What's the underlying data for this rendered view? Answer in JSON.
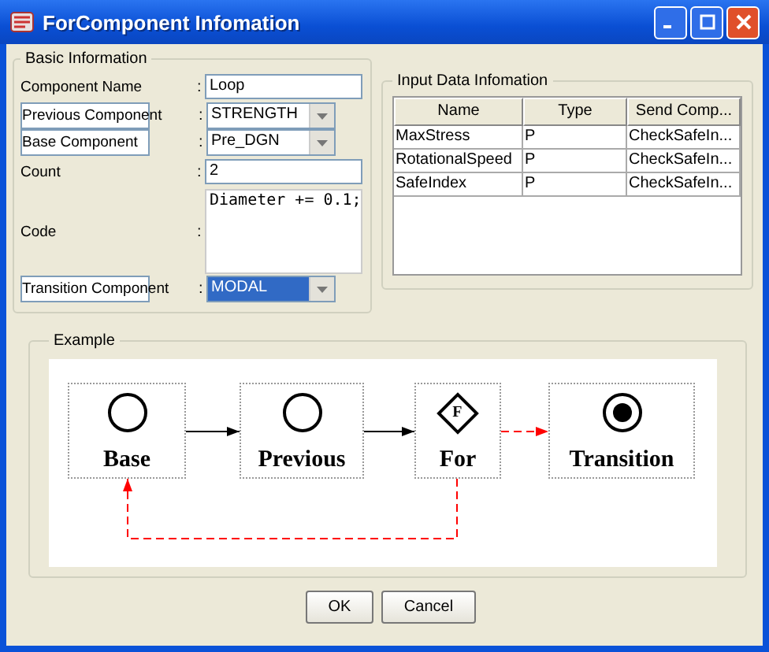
{
  "window": {
    "title": "ForComponent Infomation"
  },
  "basic_information": {
    "title": "Basic Information",
    "fields": [
      {
        "label": "Component Name",
        "colon": ":",
        "kind": "text",
        "value": "Loop",
        "focused": false
      },
      {
        "label": "Previous Component",
        "colon": ":",
        "kind": "combo",
        "value": "STRENGTH",
        "focused": false
      },
      {
        "label": "Base Component",
        "colon": ":",
        "kind": "combo",
        "value": "Pre_DGN",
        "focused": false
      },
      {
        "label": "Count",
        "colon": ":",
        "kind": "text",
        "value": "2",
        "focused": false
      },
      {
        "label": "Code",
        "colon": ":",
        "kind": "textarea",
        "value": "Diameter += 0.1;",
        "focused": false
      },
      {
        "label": "Transition Component",
        "colon": ":",
        "kind": "combo",
        "value": "MODAL",
        "focused": true
      }
    ]
  },
  "input_data": {
    "title": "Input Data Infomation",
    "columns": [
      "Name",
      "Type",
      "Send Comp..."
    ],
    "rows": [
      [
        "MaxStress",
        "P",
        "CheckSafeIn..."
      ],
      [
        "RotationalSpeed",
        "P",
        "CheckSafeIn..."
      ],
      [
        "SafeIndex",
        "P",
        "CheckSafeIn..."
      ]
    ]
  },
  "example": {
    "title": "Example",
    "nodes": [
      {
        "label": "Base",
        "kind": "circle"
      },
      {
        "label": "Previous",
        "kind": "circle"
      },
      {
        "label": "For",
        "kind": "diamond",
        "mark": "F"
      },
      {
        "label": "Transition",
        "kind": "target"
      }
    ]
  },
  "buttons": [
    "OK",
    "Cancel"
  ]
}
